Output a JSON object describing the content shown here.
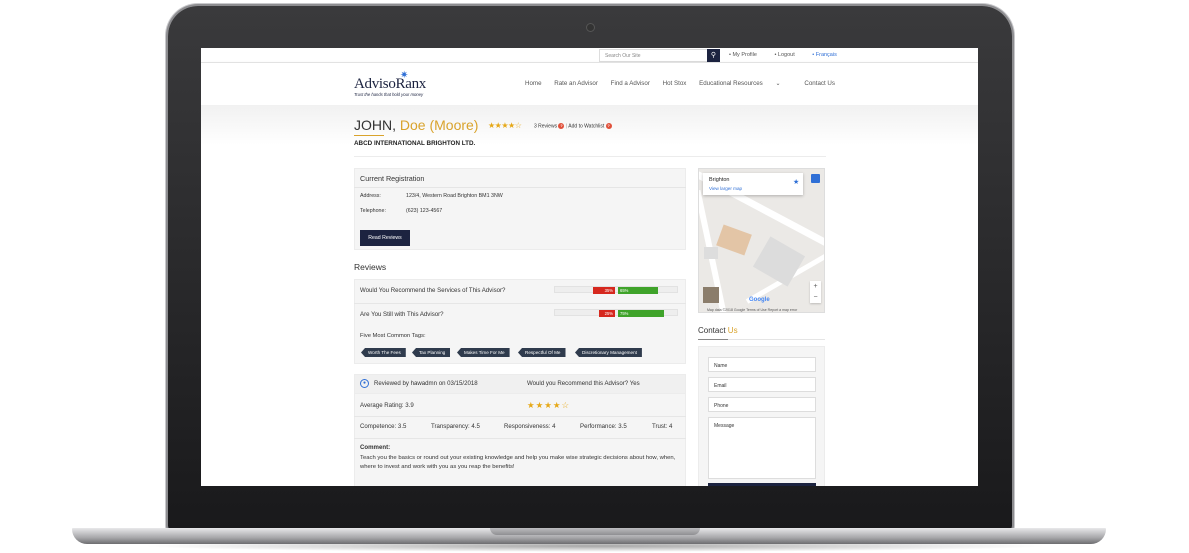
{
  "topbar": {
    "search_placeholder": "Search Our Site",
    "search_icon": "search-icon",
    "links": [
      "My Profile",
      "Logout",
      "Français"
    ]
  },
  "brand": {
    "logo": "AdvisoRanx",
    "tagline": "Trust the hands that hold your money"
  },
  "nav": [
    "Home",
    "Rate an Advisor",
    "Find a Advisor",
    "Hot Stox",
    "Educational Resources",
    "Contact Us"
  ],
  "advisor": {
    "first": "JOHN,",
    "last": "Doe (Moore)",
    "rating_stars": "★★★★☆",
    "reviews_link": "3 Reviews",
    "watchlist": "Add to Watchlist",
    "company": "ABCD INTERNATIONAL BRIGHTON LTD."
  },
  "registration": {
    "title": "Current Registration",
    "address_label": "Address:",
    "address": "123/4, Western Road Brighton BM1 3NW",
    "phone_label": "Telephone:",
    "phone": "(623) 123-4567",
    "button": "Read Reviews"
  },
  "reviews": {
    "title": "Reviews",
    "questions": [
      {
        "label": "Would You Recommend the Services of This Advisor?",
        "no": "35%",
        "yes": "65%",
        "no_pct": 35,
        "yes_pct": 65
      },
      {
        "label": "Are You Still with This Advisor?",
        "no": "25%",
        "yes": "75%",
        "no_pct": 25,
        "yes_pct": 75
      }
    ],
    "tags_title": "Five Most Common Tags:",
    "tags": [
      "Worth The Fees",
      "Tax Planning",
      "Makes Time For Me",
      "Respectful Of Me",
      "Discretionary Management"
    ]
  },
  "review": {
    "by": "Reviewed by hawadmn on 03/15/2018",
    "recommend": "Would you Recommend this Advisor? Yes",
    "average": "Average Rating: 3.9",
    "stars": "★★★★☆",
    "competence": "Competence: 3.5",
    "transparency": "Transparency: 4.5",
    "responsiveness": "Responsiveness: 4",
    "performance": "Performance: 3.5",
    "trust": "Trust: 4",
    "comment_label": "Comment:",
    "comment": "Teach you the basics or round out your existing knowledge and help you make wise strategic decisions about how, when, where to invest and work with you as you reap the benefits!"
  },
  "map": {
    "place": "Brighton",
    "larger": "View larger map",
    "google": "Google",
    "footer": "Map data ©2018 Google   Terms of Use   Report a map error"
  },
  "contact": {
    "title_a": "Contact ",
    "title_b": "Us",
    "name": "Name",
    "email": "Email",
    "phone": "Phone",
    "message": "Message"
  },
  "colors": {
    "navy": "#1c2340",
    "gold": "#d9a32c",
    "red": "#d6281e",
    "green": "#3fa32a",
    "star": "#e6a817"
  }
}
